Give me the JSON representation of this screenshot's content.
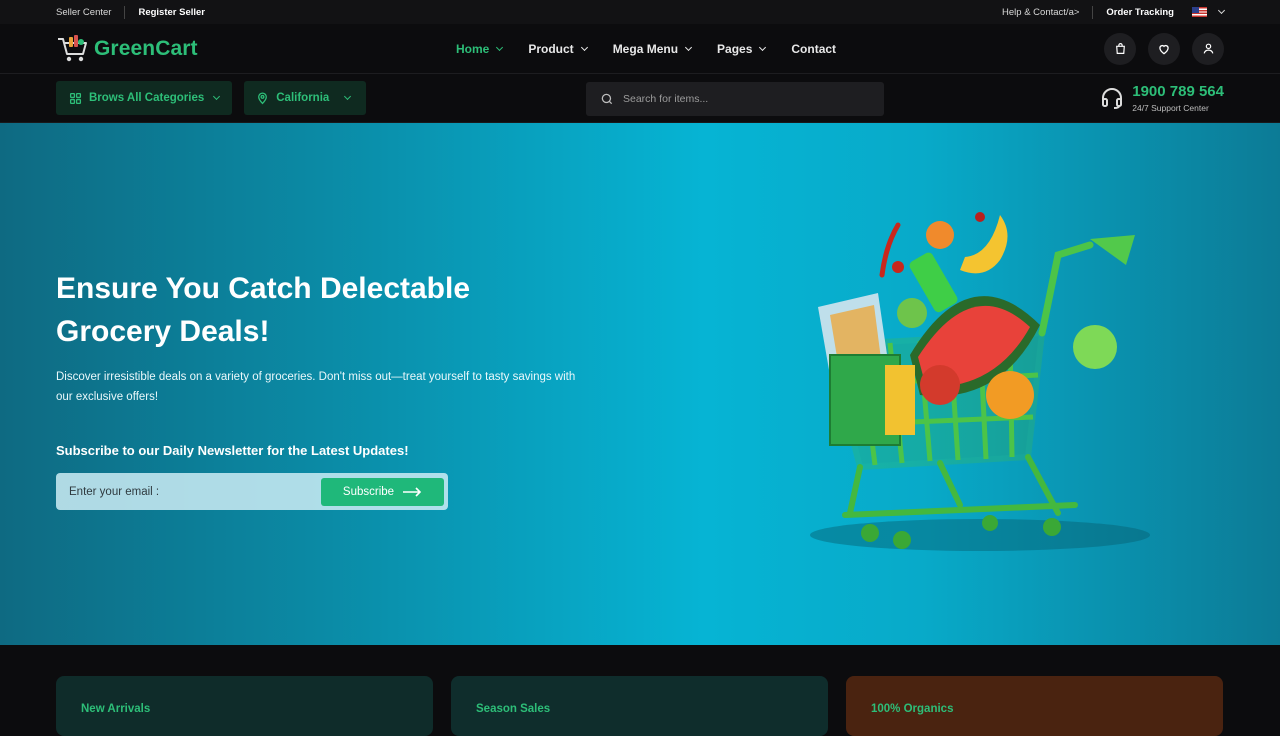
{
  "topbar": {
    "seller_center": "Seller Center",
    "register_seller": "Register Seller",
    "help_contact": "Help & Contact/a>",
    "order_tracking": "Order Tracking"
  },
  "header": {
    "logo": "GreenCart",
    "nav": [
      {
        "label": "Home",
        "active": true,
        "has_dropdown": true
      },
      {
        "label": "Product",
        "has_dropdown": true
      },
      {
        "label": "Mega Menu",
        "has_dropdown": true
      },
      {
        "label": "Pages",
        "has_dropdown": true
      },
      {
        "label": "Contact",
        "has_dropdown": false
      }
    ],
    "icons": [
      "bag-icon",
      "heart-icon",
      "user-icon"
    ]
  },
  "subbar": {
    "categories_label": "Brows All Categories",
    "location_label": "California",
    "search_placeholder": "Search for items...",
    "support_phone": "1900 789 564",
    "support_label": "24/7 Support Center"
  },
  "hero": {
    "title_line1": "Ensure You Catch Delectable",
    "title_line2": "Grocery Deals!",
    "description": "Discover irresistible deals on a variety of groceries. Don't miss out—treat yourself to tasty savings with our exclusive offers!",
    "newsletter_heading": "Subscribe to our Daily Newsletter for the Latest Updates!",
    "email_placeholder": "Enter your email :",
    "subscribe_label": "Subscribe"
  },
  "cards": [
    {
      "label": "New Arrivals"
    },
    {
      "label": "Season Sales"
    },
    {
      "label": "100% Organics"
    }
  ],
  "colors": {
    "accent": "#2dbe78",
    "hero_bg": "#06b4d4",
    "button": "#1fb87a"
  }
}
